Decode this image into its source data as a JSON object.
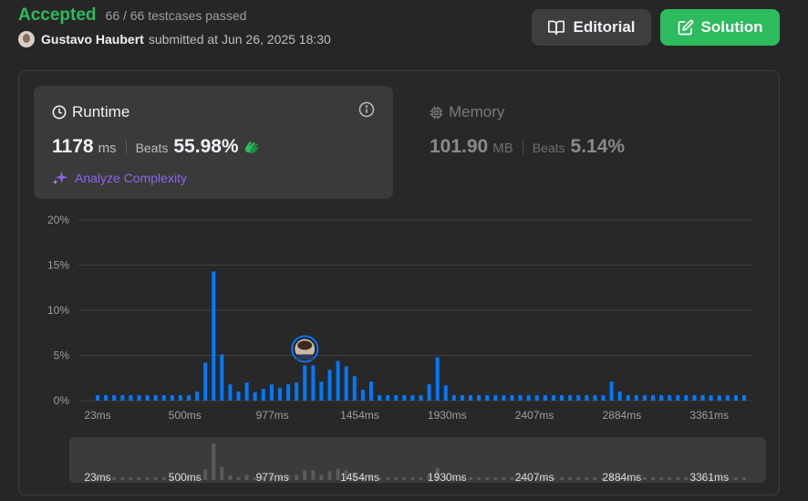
{
  "header": {
    "status": "Accepted",
    "testcases": "66 / 66 testcases passed",
    "username": "Gustavo Haubert",
    "submitted_text": "submitted at Jun 26, 2025 18:30"
  },
  "buttons": {
    "editorial": "Editorial",
    "solution": "Solution"
  },
  "runtime": {
    "title": "Runtime",
    "value": "1178",
    "unit": "ms",
    "beats_label": "Beats",
    "beats_value": "55.98%",
    "analyze": "Analyze Complexity"
  },
  "memory": {
    "title": "Memory",
    "value": "101.90",
    "unit": "MB",
    "beats_label": "Beats",
    "beats_value": "5.14%"
  },
  "colors": {
    "accepted": "#2cbb5d",
    "bar": "#007aff",
    "analyze": "#8f63e8",
    "mini_bar": "#5a5a5a"
  },
  "chart_data": {
    "type": "bar",
    "ylim": [
      0,
      20
    ],
    "y_ticks": [
      "20%",
      "15%",
      "10%",
      "5%",
      "0%"
    ],
    "y_tick_values": [
      20,
      15,
      10,
      5,
      0
    ],
    "x_ticks": [
      "23ms",
      "500ms",
      "977ms",
      "1454ms",
      "1930ms",
      "2407ms",
      "2884ms",
      "3361ms"
    ],
    "values": [
      0.6,
      0.6,
      0.6,
      0.6,
      0.6,
      0.6,
      0.6,
      0.6,
      0.6,
      0.6,
      0.6,
      0.6,
      1.0,
      4.2,
      14.3,
      5.1,
      1.8,
      1.0,
      2.0,
      0.9,
      1.3,
      1.8,
      1.4,
      1.8,
      2.0,
      3.9,
      3.9,
      2.1,
      3.4,
      4.4,
      3.8,
      2.7,
      1.2,
      2.1,
      0.6,
      0.6,
      0.6,
      0.6,
      0.6,
      0.6,
      1.8,
      4.8,
      1.7,
      0.6,
      0.6,
      0.6,
      0.6,
      0.6,
      0.6,
      0.6,
      0.6,
      0.6,
      0.6,
      0.6,
      0.6,
      0.6,
      0.6,
      0.6,
      0.6,
      0.6,
      0.6,
      0.6,
      2.1,
      1.0,
      0.6,
      0.6,
      0.6,
      0.6,
      0.6,
      0.6,
      0.6,
      0.6,
      0.6,
      0.6,
      0.6,
      0.6,
      0.6,
      0.6,
      0.6
    ],
    "user_bar_index": 25
  }
}
